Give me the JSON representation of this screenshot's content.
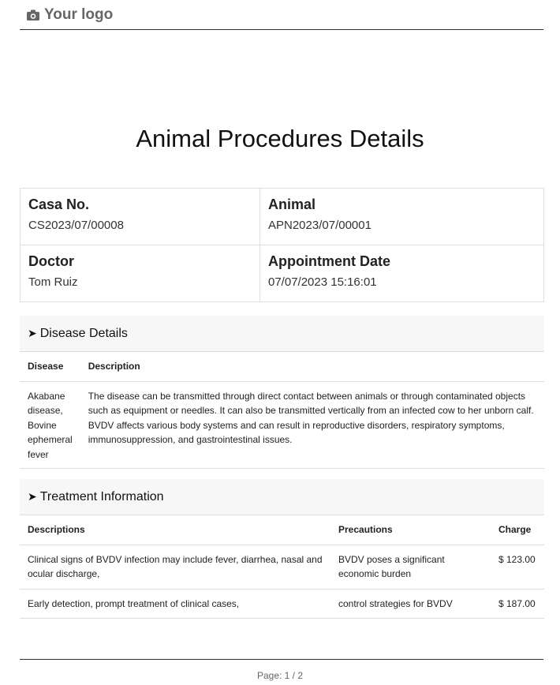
{
  "header": {
    "logo_text": "Your logo",
    "logo_icon": "camera-icon"
  },
  "title": "Animal Procedures Details",
  "info": {
    "casa_label": "Casa No.",
    "casa_value": "CS2023/07/00008",
    "animal_label": "Animal",
    "animal_value": "APN2023/07/00001",
    "doctor_label": "Doctor",
    "doctor_value": "Tom Ruiz",
    "appt_label": "Appointment Date",
    "appt_value": "07/07/2023 15:16:01"
  },
  "disease_section": {
    "heading": "Disease Details",
    "columns": {
      "disease": "Disease",
      "description": "Description"
    },
    "rows": [
      {
        "disease": "Akabane disease, Bovine ephemeral fever",
        "description": "The disease can be transmitted through direct contact between animals or through contaminated objects such as equipment or needles. It can also be transmitted vertically from an infected cow to her unborn calf. BVDV affects various body systems and can result in reproductive disorders, respiratory symptoms, immunosuppression, and gastrointestinal issues."
      }
    ]
  },
  "treatment_section": {
    "heading": "Treatment Information",
    "columns": {
      "descriptions": "Descriptions",
      "precautions": "Precautions",
      "charge": "Charge"
    },
    "rows": [
      {
        "description": "Clinical signs of BVDV infection may include fever, diarrhea, nasal and ocular discharge,",
        "precaution": "BVDV poses a significant economic burden",
        "charge": "$ 123.00"
      },
      {
        "description": "Early detection, prompt treatment of clinical cases,",
        "precaution": "control strategies for BVDV",
        "charge": "$ 187.00"
      }
    ]
  },
  "footer": {
    "page": "Page: 1 / 2"
  }
}
